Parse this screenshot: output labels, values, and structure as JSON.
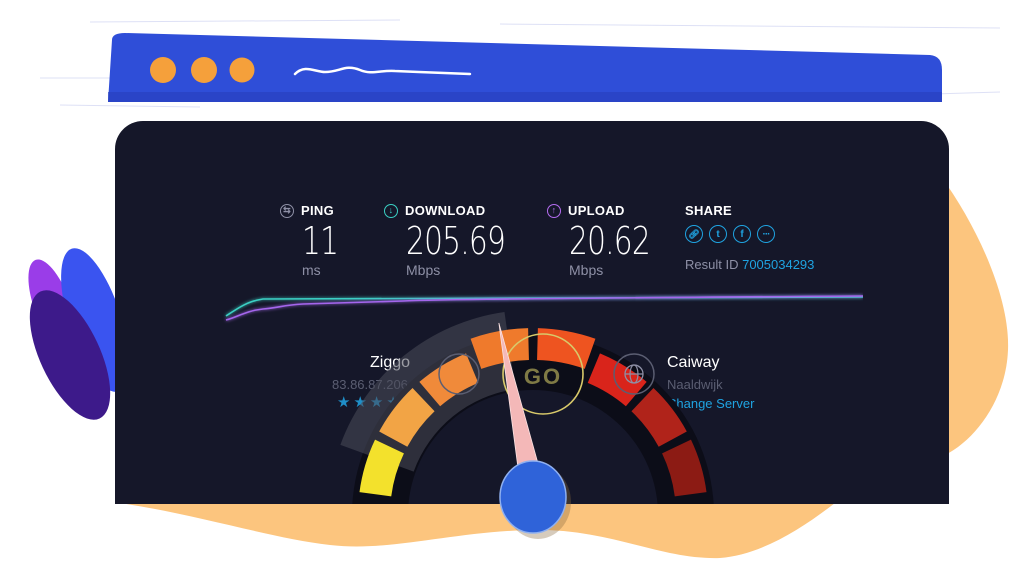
{
  "browser": {
    "window_dots": [
      "dot-1",
      "dot-2",
      "dot-3"
    ],
    "colors": {
      "bar": "#2f4ed8",
      "dot": "#f5a03b",
      "squiggle": "#ffffff"
    }
  },
  "stats": {
    "ping": {
      "label": "PING",
      "value": "11",
      "unit": "ms",
      "icon": "ping-icon",
      "icon_glyph": "⇆",
      "icon_color": "#8e90a6"
    },
    "download": {
      "label": "DOWNLOAD",
      "value": "205.69",
      "unit": "Mbps",
      "icon": "download-arrow-icon",
      "icon_glyph": "↓",
      "icon_color": "#3ad0c4"
    },
    "upload": {
      "label": "UPLOAD",
      "value": "20.62",
      "unit": "Mbps",
      "icon": "upload-arrow-icon",
      "icon_glyph": "↑",
      "icon_color": "#b46cf0"
    }
  },
  "share": {
    "label": "SHARE",
    "buttons": [
      {
        "name": "link",
        "glyph": "🔗︎"
      },
      {
        "name": "twitter",
        "glyph": "t"
      },
      {
        "name": "facebook",
        "glyph": "f"
      },
      {
        "name": "more",
        "glyph": "···"
      }
    ],
    "result_label": "Result ID",
    "result_id": "7005034293"
  },
  "isp": {
    "name": "Ziggo",
    "ip": "83.86.87.206",
    "rating_stars": 4,
    "stars_text": "★★★★"
  },
  "server": {
    "name": "Caiway",
    "location": "Naaldwijk",
    "change_label": "Change Server"
  },
  "gauge": {
    "go_label": "GO",
    "needle_fraction": 0.44,
    "segment_colors": [
      "#f3e12c",
      "#f2a445",
      "#f08a3a",
      "#ef7a2c",
      "#ee5420",
      "#d9241b",
      "#b0231a",
      "#8c1b14"
    ]
  },
  "graph": {
    "download_color": "#3ad0c4",
    "upload_color": "#a466ec"
  }
}
